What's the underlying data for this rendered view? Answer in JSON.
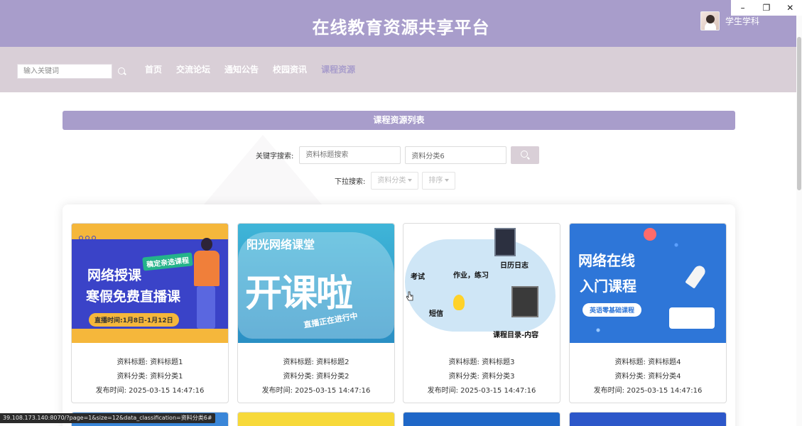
{
  "window": {
    "minimize_icon": "minimize-icon",
    "restore_icon": "restore-icon",
    "close_icon": "close-icon"
  },
  "header": {
    "title": "在线教育资源共享平台",
    "user": {
      "name": "学生学科"
    }
  },
  "nav": {
    "search_placeholder": "输入关键词",
    "links": [
      {
        "label": "首页",
        "active": false
      },
      {
        "label": "交流论坛",
        "active": false
      },
      {
        "label": "通知公告",
        "active": false
      },
      {
        "label": "校园资讯",
        "active": false
      },
      {
        "label": "课程资源",
        "active": true
      }
    ]
  },
  "main": {
    "section_title": "课程资源列表",
    "filters": {
      "keyword_label": "关键字搜索:",
      "title_placeholder": "资料标题搜索",
      "category_value": "资料分类6",
      "dropdown_label": "下拉搜索:",
      "dropdowns": [
        {
          "label": "资料分类"
        },
        {
          "label": "排序"
        }
      ]
    },
    "cards": [
      {
        "image": {
          "title_line1": "网络授课",
          "title_line2": "寒假免费直播课",
          "badge": "稿定亲选课程",
          "pill": "直播时间:1月8日-1月12日"
        },
        "title_line": "资料标题: 资料标题1",
        "category_line": "资料分类: 资料分类1",
        "time_line": "发布时间: 2025-03-15 14:47:16"
      },
      {
        "image": {
          "title_line1": "阳光网络课堂",
          "title_line2": "开课啦",
          "sub": "直播正在进行中"
        },
        "title_line": "资料标题: 资料标题2",
        "category_line": "资料分类: 资料分类2",
        "time_line": "发布时间: 2025-03-15 14:47:16"
      },
      {
        "image": {
          "labels": [
            "考试",
            "作业，练习",
            "日历日志",
            "短信",
            "课程目录-内容"
          ]
        },
        "title_line": "资料标题: 资料标题3",
        "category_line": "资料分类: 资料分类3",
        "time_line": "发布时间: 2025-03-15 14:47:16"
      },
      {
        "image": {
          "title_line1": "网络在线",
          "title_line2": "入门课程",
          "pill": "英语零基础课程"
        },
        "title_line": "资料标题: 资料标题4",
        "category_line": "资料分类: 资料分类4",
        "time_line": "发布时间: 2025-03-15 14:47:16"
      }
    ]
  },
  "status_url": "39.108.173.140:8070/?page=1&size=12&data_classification=资料分类6#",
  "colors": {
    "primary": "#a89dcb",
    "nav_bg": "#d9cfd7",
    "active_link": "#a89dcb"
  }
}
